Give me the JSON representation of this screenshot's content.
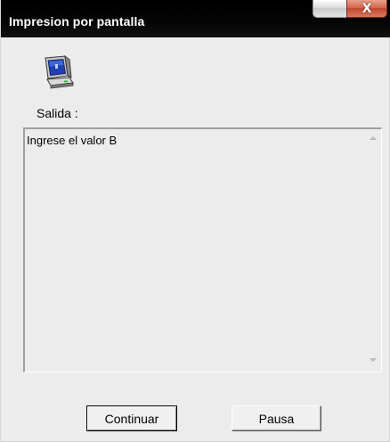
{
  "window": {
    "title": "Impresion por pantalla",
    "close_glyph": "X"
  },
  "icons": {
    "computer": "computer-monitor-icon",
    "close": "close-icon",
    "scroll_up": "scroll-up-arrow-icon",
    "scroll_down": "scroll-down-arrow-icon"
  },
  "output": {
    "label": "Salida :",
    "text": "Ingrese el valor B"
  },
  "buttons": {
    "continue_label": "Continuar",
    "pause_label": "Pausa"
  },
  "colors": {
    "titlebar": "#000000",
    "window_bg": "#ececec",
    "close_button": "#c2472d"
  }
}
